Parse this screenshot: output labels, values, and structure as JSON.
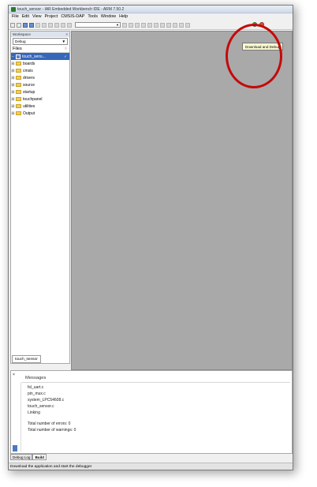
{
  "window": {
    "title": "touch_sensor - IAR Embedded Workbench IDE - ARM 7.50.2"
  },
  "menu": [
    "File",
    "Edit",
    "View",
    "Project",
    "CMSIS-DAP",
    "Tools",
    "Window",
    "Help"
  ],
  "workspace": {
    "header": "Workspace",
    "config": "Debug",
    "files_label": "Files",
    "tab_label": "touch_sensor",
    "tree": [
      {
        "label": "touch_sens...",
        "type": "project",
        "selected": true,
        "checked": "✓"
      },
      {
        "label": "boards",
        "type": "folder"
      },
      {
        "label": "cmsis",
        "type": "folder"
      },
      {
        "label": "drivers",
        "type": "folder"
      },
      {
        "label": "source",
        "type": "folder"
      },
      {
        "label": "startup",
        "type": "folder"
      },
      {
        "label": "touchpanel",
        "type": "folder"
      },
      {
        "label": "utilities",
        "type": "folder"
      },
      {
        "label": "Output",
        "type": "folder"
      }
    ]
  },
  "tooltip": {
    "text": "Download and Debug"
  },
  "messages": {
    "title": "Messages",
    "lines": [
      "fsl_uart.c",
      "pin_mux.c",
      "system_LPC54608.c",
      "touch_sensor.c",
      "Linking",
      "",
      "Total number of errors: 0",
      "Total number of warnings: 0"
    ]
  },
  "bottom_tabs": [
    "Debug Log",
    "Build"
  ],
  "status": {
    "text": "Download the application and start the debugger"
  },
  "colors": {
    "highlight_ring": "#c40a0a",
    "selection": "#3667b8",
    "editor_bg": "#a9a9a9"
  }
}
